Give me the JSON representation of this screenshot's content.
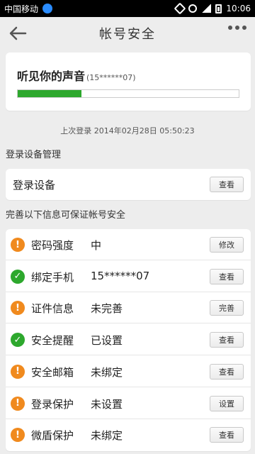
{
  "statusbar": {
    "carrier": "中国移动",
    "time": "10:06"
  },
  "header": {
    "title": "帐号安全"
  },
  "voice": {
    "title": "听见你的声音",
    "phone": "(15******07)",
    "progress": 0.29,
    "progress_color": "#2da82d"
  },
  "last_login": "上次登录 2014年02月28日 05:50:23",
  "device_section": {
    "title": "登录设备管理",
    "row_label": "登录设备",
    "button": "查看"
  },
  "security_section": {
    "title": "完善以下信息可保证帐号安全",
    "rows": [
      {
        "status": "warning",
        "icon": "warning-icon",
        "name": "密码强度",
        "value": "中",
        "button": "修改"
      },
      {
        "status": "ok",
        "icon": "check-icon",
        "name": "绑定手机",
        "value": "15******07",
        "button": "查看"
      },
      {
        "status": "warning",
        "icon": "warning-icon",
        "name": "证件信息",
        "value": "未完善",
        "button": "完善"
      },
      {
        "status": "ok",
        "icon": "check-icon",
        "name": "安全提醒",
        "value": "已设置",
        "button": "查看"
      },
      {
        "status": "warning",
        "icon": "warning-icon",
        "name": "安全邮箱",
        "value": "未绑定",
        "button": "查看"
      },
      {
        "status": "warning",
        "icon": "warning-icon",
        "name": "登录保护",
        "value": "未设置",
        "button": "设置"
      },
      {
        "status": "warning",
        "icon": "warning-icon",
        "name": "微盾保护",
        "value": "未绑定",
        "button": "查看"
      }
    ]
  }
}
